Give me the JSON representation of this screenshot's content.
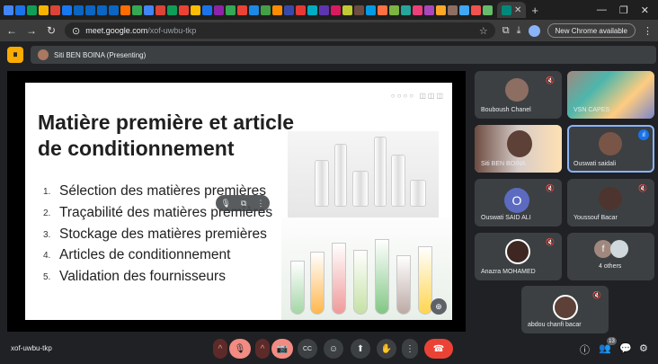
{
  "browser": {
    "tab_label": "",
    "new_tab": "+",
    "window_controls": [
      "—",
      "❐",
      "✕"
    ],
    "url_host": "meet.google.com",
    "url_path": "/xof-uwbu-tkp",
    "update_label": "New Chrome available",
    "favicon_colors": [
      "#4285f4",
      "#1a73e8",
      "#0f9d58",
      "#f4b400",
      "#db4437",
      "#1877f2",
      "#0a66c2",
      "#0a66c2",
      "#0a66c2",
      "#0a66c2",
      "#ff6d00",
      "#34a853",
      "#4285f4",
      "#db4437",
      "#0f9d58",
      "#ea4335",
      "#fbbc04",
      "#1a73e8",
      "#8e24aa",
      "#34a853",
      "#ea4335",
      "#1e88e5",
      "#43a047",
      "#fb8c00",
      "#3949ab",
      "#e53935",
      "#00acc1",
      "#5e35b1",
      "#d81b60",
      "#c0ca33",
      "#6d4c41",
      "#039be5",
      "#ff7043",
      "#7cb342",
      "#26a69a",
      "#ec407a",
      "#ab47bc",
      "#ffa726",
      "#8d6e63",
      "#42a5f5",
      "#ef5350",
      "#66bb6a"
    ]
  },
  "presenting_bar": {
    "label": "Siti BEN BOINA (Presenting)",
    "record_icon": "⏺"
  },
  "slide": {
    "deco": "○○○○  ◫◫◫",
    "title": "Matière première et article de conditionnement",
    "items": [
      {
        "num": "1.",
        "text": "Sélection des matières premières"
      },
      {
        "num": "2.",
        "text": "Traçabilité des matières premières"
      },
      {
        "num": "3.",
        "text": "Stockage des matières premières"
      },
      {
        "num": "4.",
        "text": "Articles de conditionnement"
      },
      {
        "num": "5.",
        "text": "Validation des fournisseurs"
      }
    ]
  },
  "participants": [
    {
      "name": "Bouboush Chanel",
      "muted": true
    },
    {
      "name": "VSN CAPES",
      "muted": false
    },
    {
      "name": "Siti BEN BOINA",
      "muted": false
    },
    {
      "name": "Ouswati saidali",
      "muted": false,
      "speaking": true
    },
    {
      "name": "Ouswati SAID ALI",
      "muted": true,
      "initial": "O"
    },
    {
      "name": "Youssouf Bacar",
      "muted": true
    },
    {
      "name": "Anazra MOHAMED",
      "muted": true
    },
    {
      "name": "4 others",
      "muted": false,
      "initial": "f"
    },
    {
      "name": "abdou chanfi bacar",
      "muted": true
    }
  ],
  "bottom": {
    "meeting_code": "xof-uwbu-tkp",
    "participant_count": "13",
    "icons": {
      "mic": "🎙",
      "cam": "📷",
      "captions": "CC",
      "emoji": "☺",
      "present": "⬆",
      "hand": "✋",
      "more": "⋮",
      "end": "☎",
      "info": "ⓘ",
      "people": "👥",
      "chat": "💬",
      "activities": "⚙"
    }
  }
}
